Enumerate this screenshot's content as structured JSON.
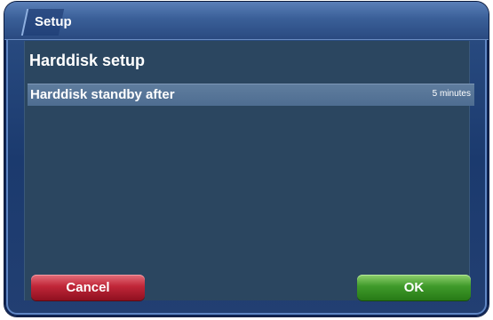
{
  "window": {
    "title": "Setup"
  },
  "main": {
    "heading": "Harddisk setup",
    "settings": [
      {
        "label": "Harddisk standby after",
        "value": "5 minutes"
      }
    ]
  },
  "buttons": {
    "cancel_label": "Cancel",
    "ok_label": "OK"
  },
  "colors": {
    "cancel": "#c02638",
    "ok": "#3f9a2a",
    "selection": "#5a7898"
  }
}
